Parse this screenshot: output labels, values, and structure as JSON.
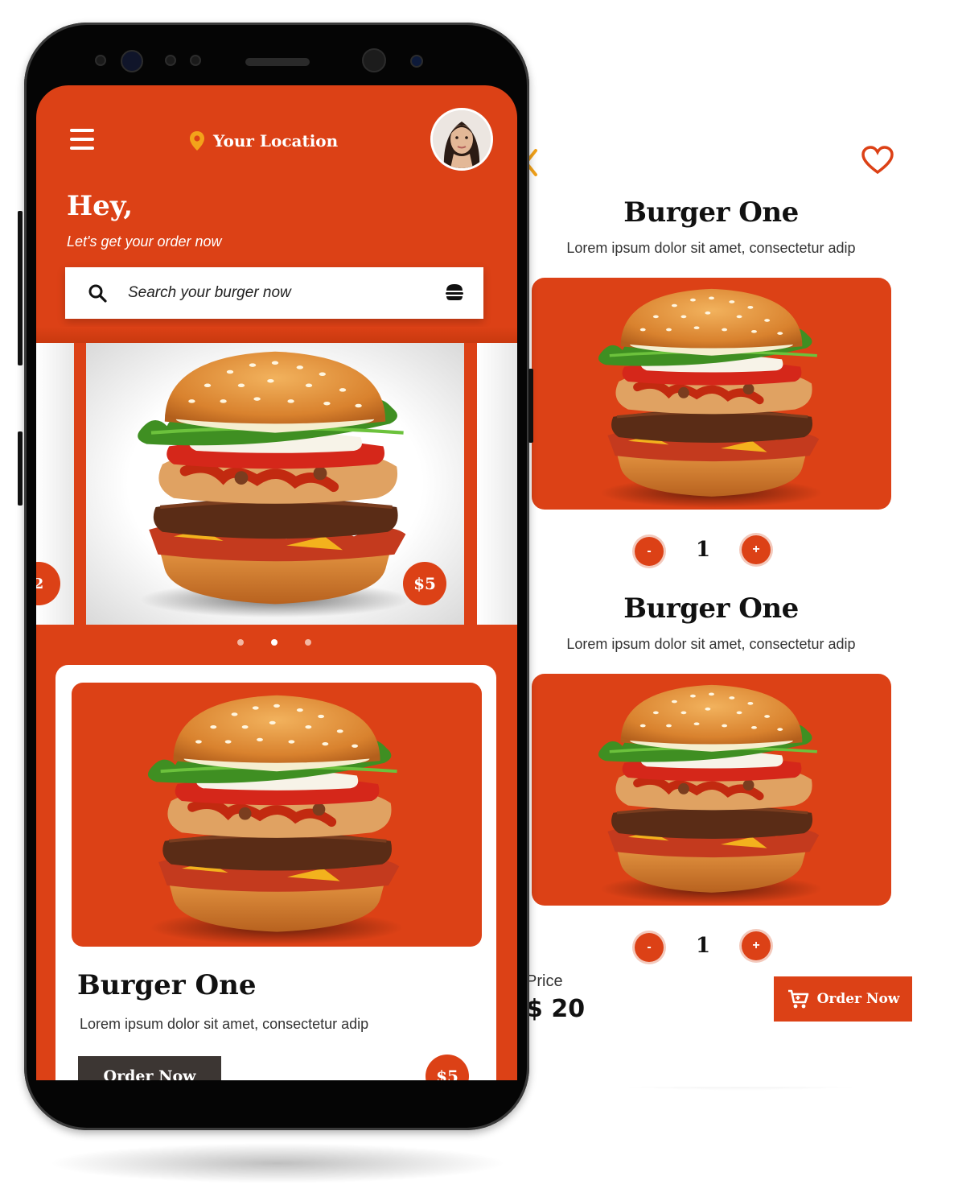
{
  "colors": {
    "accent": "#dc4116",
    "dark_button": "#3c3633",
    "pin": "#f3a21a"
  },
  "home": {
    "location_label": "Your Location",
    "greeting": "Hey,",
    "subtitle": "Let's get your order now",
    "search": {
      "placeholder": "Search your burger now"
    },
    "carousel": {
      "left_partial_price": "2",
      "main_price": "$5",
      "dots": 3,
      "active_dot_index": 1
    },
    "card": {
      "title": "Burger One",
      "description": "Lorem ipsum dolor sit amet, consectetur adip",
      "button_label": "Order Now",
      "price": "$5"
    }
  },
  "detail": {
    "items": [
      {
        "title": "Burger One",
        "description": "Lorem ipsum dolor sit amet, consectetur adip",
        "quantity": "1",
        "minus_label": "-",
        "plus_label": "+"
      },
      {
        "title": "Burger One",
        "description": "Lorem ipsum dolor sit amet, consectetur adip",
        "quantity": "1",
        "minus_label": "-",
        "plus_label": "+"
      }
    ],
    "price_label": "Price",
    "price_value": "$ 20",
    "order_button": "Order Now"
  }
}
